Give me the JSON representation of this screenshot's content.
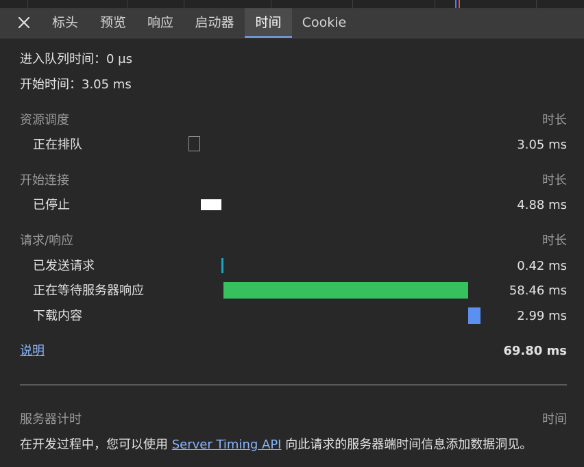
{
  "tabs": [
    {
      "label": "标头"
    },
    {
      "label": "预览"
    },
    {
      "label": "响应"
    },
    {
      "label": "启动器"
    },
    {
      "label": "时间",
      "active": true
    },
    {
      "label": "Cookie"
    }
  ],
  "summary": {
    "queued": "进入队列时间：0 μs",
    "started": "开始时间：3.05 ms"
  },
  "sections": {
    "scheduling": {
      "title": "资源调度",
      "duration_header": "时长",
      "rows": [
        {
          "label": "正在排队",
          "value": "3.05 ms",
          "ms": 3.05,
          "color": "#282828"
        }
      ]
    },
    "connection": {
      "title": "开始连接",
      "duration_header": "时长",
      "rows": [
        {
          "label": "已停止",
          "value": "4.88 ms",
          "ms": 4.88,
          "color": "#ffffff"
        }
      ]
    },
    "request": {
      "title": "请求/响应",
      "duration_header": "时长",
      "rows": [
        {
          "label": "已发送请求",
          "value": "0.42 ms",
          "ms": 0.42,
          "color": "#1aa6c8"
        },
        {
          "label": "正在等待服务器响应",
          "value": "58.46 ms",
          "ms": 58.46,
          "color": "#36c05e"
        },
        {
          "label": "下载内容",
          "value": "2.99 ms",
          "ms": 2.99,
          "color": "#5b8ff0"
        }
      ]
    }
  },
  "explanation_link": "说明",
  "total": "69.80 ms",
  "server_timing": {
    "title": "服务器计时",
    "time_header": "时间",
    "desc_before": "在开发过程中，您可以使用 ",
    "api_link": "Server Timing API",
    "desc_after": " 向此请求的服务器端时间信息添加数据洞见。"
  },
  "colors": {
    "background": "#282828",
    "tab_active_indicator": "#7cacf8",
    "link": "#8ab4f8"
  }
}
